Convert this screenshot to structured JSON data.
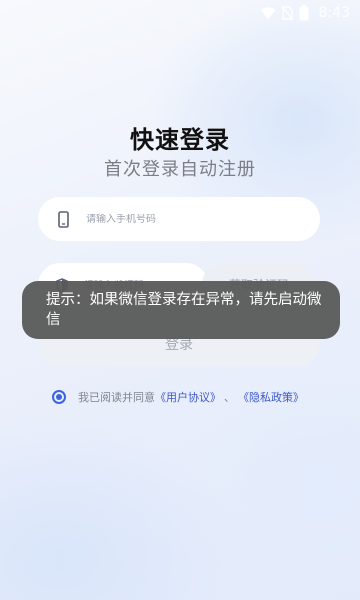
{
  "status_bar": {
    "time": "8:43",
    "battery_label": "8",
    "icons": [
      "wifi-icon",
      "no-sim-icon",
      "battery-icon"
    ]
  },
  "login": {
    "title": "快速登录",
    "subtitle": "首次登录自动注册",
    "phone_placeholder": "请输入手机号码",
    "code_placeholder": "请输入验证码",
    "get_code_label": "获取验证码",
    "login_label": "登录"
  },
  "agreement": {
    "checked": true,
    "prefix": "我已阅读并同意",
    "user_agreement": "《用户协议》",
    "separator": "、",
    "privacy_policy": "《隐私政策》"
  },
  "toast": {
    "message": "提示：如果微信登录存在异常，请先启动微信"
  },
  "colors": {
    "accent": "#3e63e0",
    "link": "#3e59c8",
    "toast_bg": "#585858"
  }
}
